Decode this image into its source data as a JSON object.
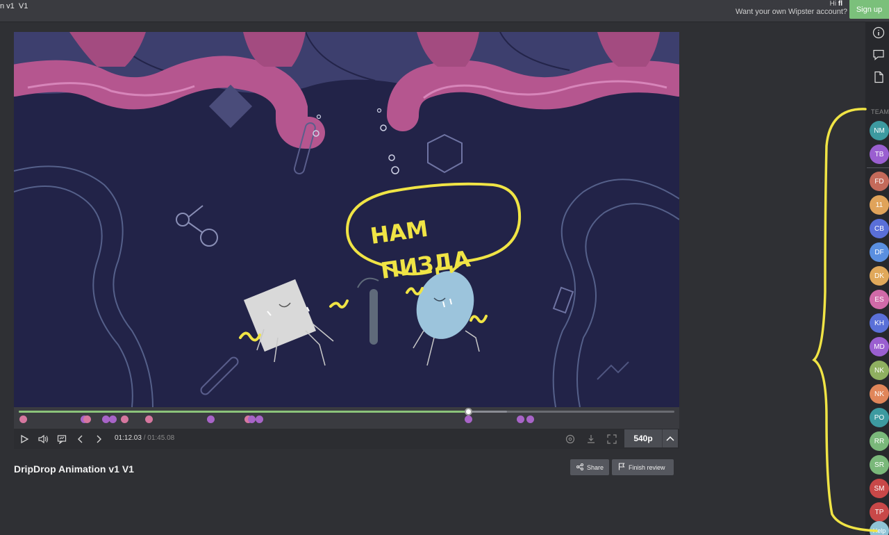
{
  "topbar": {
    "breadcrumb": "n v1  V1",
    "greeting": "Hi",
    "greeting_name": "fl",
    "promo": "Want your own Wipster account?",
    "signup_label": "Sign up"
  },
  "player": {
    "handwritten_text": [
      "НАМ",
      "ПИЗДА"
    ],
    "current_time": "01:12.03",
    "total_time": "/ 01:45.08",
    "quality_label": "540p",
    "progress_played": 0.685,
    "progress_buffered": 0.745,
    "markers": [
      {
        "pos": 0.006,
        "color": "#d6779f"
      },
      {
        "pos": 0.1,
        "color": "#a864c8"
      },
      {
        "pos": 0.104,
        "color": "#d6779f"
      },
      {
        "pos": 0.132,
        "color": "#a864c8"
      },
      {
        "pos": 0.143,
        "color": "#a864c8"
      },
      {
        "pos": 0.161,
        "color": "#d6779f"
      },
      {
        "pos": 0.198,
        "color": "#d6779f"
      },
      {
        "pos": 0.292,
        "color": "#a864c8"
      },
      {
        "pos": 0.35,
        "color": "#d6779f"
      },
      {
        "pos": 0.355,
        "color": "#a864c8"
      },
      {
        "pos": 0.367,
        "color": "#a864c8"
      },
      {
        "pos": 0.685,
        "color": "#a864c8"
      },
      {
        "pos": 0.765,
        "color": "#a864c8"
      },
      {
        "pos": 0.78,
        "color": "#a864c8"
      }
    ]
  },
  "video_title": "DripDrop Animation v1 V1",
  "actions": {
    "share_label": "Share",
    "finish_label": "Finish review"
  },
  "rail": {
    "team_label": "TEAM",
    "team": [
      {
        "initials": "NM",
        "color": "#3d9aa0"
      },
      {
        "initials": "TB",
        "color": "#9a5fd0"
      }
    ],
    "reviewers": [
      {
        "initials": "FD",
        "color": "#c46a5a"
      },
      {
        "initials": "11",
        "color": "#e0a35a"
      },
      {
        "initials": "CB",
        "color": "#5a6fd8"
      },
      {
        "initials": "DF",
        "color": "#5a8fe0"
      },
      {
        "initials": "DK",
        "color": "#e0a85a"
      },
      {
        "initials": "ES",
        "color": "#d06aa8"
      },
      {
        "initials": "KH",
        "color": "#5a70d8"
      },
      {
        "initials": "MD",
        "color": "#9a5fd0"
      },
      {
        "initials": "NK",
        "color": "#8fb060"
      },
      {
        "initials": "NK",
        "color": "#e0865a"
      },
      {
        "initials": "PO",
        "color": "#3d9aa0"
      },
      {
        "initials": "RR",
        "color": "#7ab87a"
      },
      {
        "initials": "SR",
        "color": "#7ab87a"
      },
      {
        "initials": "SM",
        "color": "#c84848"
      },
      {
        "initials": "TP",
        "color": "#c84848"
      }
    ],
    "help_label": "Help"
  }
}
